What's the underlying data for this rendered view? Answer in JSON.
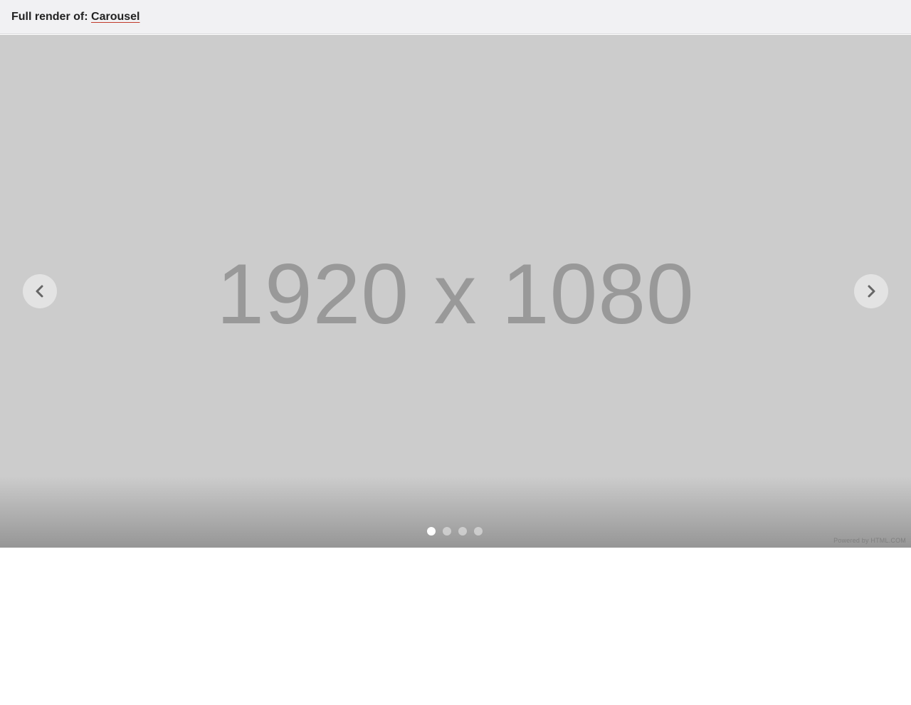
{
  "header": {
    "prefix": "Full render of:",
    "link_label": "Carousel"
  },
  "carousel": {
    "slide_text": "1920 x 1080",
    "slide_count": 4,
    "active_index": 0,
    "prev_icon": "chevron-left-icon",
    "next_icon": "chevron-right-icon",
    "footer": "Powered by HTML.COM"
  },
  "colors": {
    "slide_bg": "#cccccc",
    "slide_text": "#999999",
    "header_bg": "#f1f1f3",
    "link_underline": "#c0392b"
  }
}
